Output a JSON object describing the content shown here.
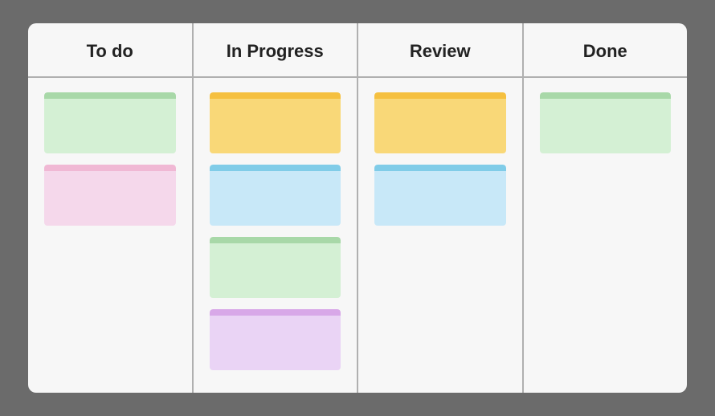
{
  "board": {
    "columns": [
      {
        "id": "todo",
        "label": "To do",
        "cards": [
          {
            "id": "todo-1",
            "color": "green"
          },
          {
            "id": "todo-2",
            "color": "pink"
          }
        ]
      },
      {
        "id": "in-progress",
        "label": "In Progress",
        "cards": [
          {
            "id": "ip-1",
            "color": "yellow"
          },
          {
            "id": "ip-2",
            "color": "blue"
          },
          {
            "id": "ip-3",
            "color": "lightgreen"
          },
          {
            "id": "ip-4",
            "color": "lavender"
          }
        ]
      },
      {
        "id": "review",
        "label": "Review",
        "cards": [
          {
            "id": "rv-1",
            "color": "yellow-sm"
          },
          {
            "id": "rv-2",
            "color": "blue-sm"
          }
        ]
      },
      {
        "id": "done",
        "label": "Done",
        "cards": [
          {
            "id": "done-1",
            "color": "green-done"
          }
        ]
      }
    ]
  }
}
